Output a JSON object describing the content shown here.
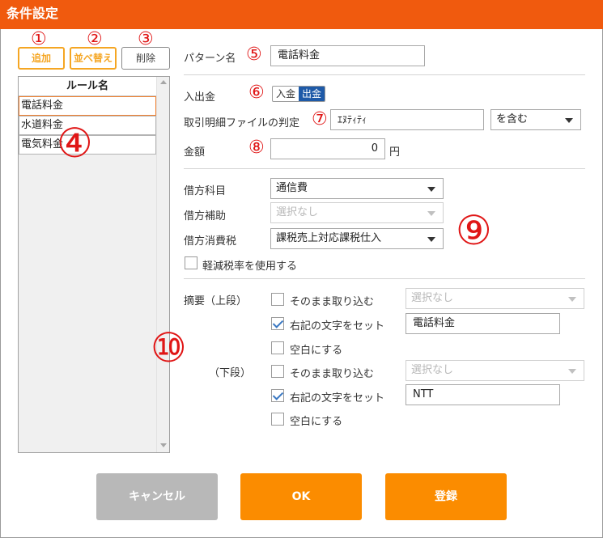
{
  "window": {
    "title": "条件設定"
  },
  "annotations": {
    "a1": "①",
    "a2": "②",
    "a3": "③",
    "a4": "④",
    "a5": "⑤",
    "a6": "⑥",
    "a7": "⑦",
    "a8": "⑧",
    "a9": "⑨",
    "a10": "⑩"
  },
  "toolbar": {
    "add_label": "追加",
    "sort_label": "並べ替え",
    "delete_label": "削除"
  },
  "rule_list": {
    "header": "ルール名",
    "items": [
      "電話料金",
      "水道料金",
      "電気料金"
    ],
    "selected_index": 0
  },
  "form": {
    "pattern_name_label": "パターン名",
    "pattern_name_value": "電話料金",
    "inout_label": "入出金",
    "inout_options": [
      "入金",
      "出金"
    ],
    "inout_selected": "出金",
    "statement_label": "取引明細ファイルの判定",
    "statement_value": "ｴﾇﾃｨﾃｨ",
    "match_select": "を含む",
    "amount_label": "金額",
    "amount_value": "0",
    "amount_unit": "円",
    "debit_account_label": "借方科目",
    "debit_account_value": "通信費",
    "debit_sub_label": "借方補助",
    "debit_sub_value": "選択なし",
    "debit_tax_label": "借方消費税",
    "debit_tax_value": "課税売上対応課税仕入",
    "reduced_tax_label": "軽減税率を使用する",
    "reduced_tax_checked": false,
    "summary_upper_label": "摘要（上段）",
    "summary_lower_label": "（下段）",
    "upper": {
      "import_as_is_label": "そのまま取り込む",
      "import_as_is_checked": false,
      "import_select": "選択なし",
      "set_text_label": "右記の文字をセット",
      "set_text_checked": true,
      "set_text_value": "電話料金",
      "blank_label": "空白にする",
      "blank_checked": false
    },
    "lower": {
      "import_as_is_label": "そのまま取り込む",
      "import_as_is_checked": false,
      "import_select": "選択なし",
      "set_text_label": "右記の文字をセット",
      "set_text_checked": true,
      "set_text_value": "NTT",
      "blank_label": "空白にする",
      "blank_checked": false
    }
  },
  "footer": {
    "cancel_label": "キャンセル",
    "ok_label": "OK",
    "register_label": "登録"
  },
  "colors": {
    "title_bar": "#f05a0e",
    "accent_orange": "#fb8c00",
    "toggle_active": "#1e5aa8",
    "annotation_red": "#e01616",
    "cancel_gray": "#b8b8b8"
  }
}
